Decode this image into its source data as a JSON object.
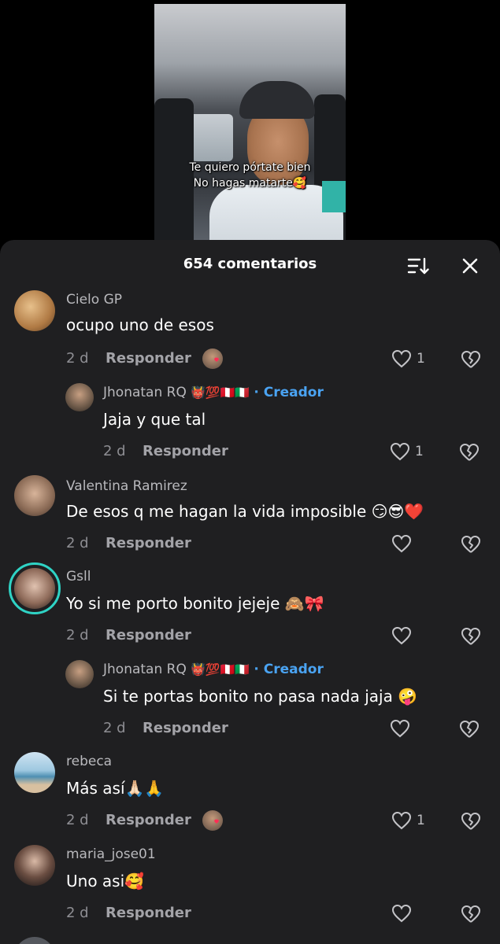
{
  "video": {
    "caption_line1": "Te quiero pórtate bien",
    "caption_line2": "No hagas matarte🥰"
  },
  "header": {
    "title": "654 comentarios",
    "sort_icon": "sort-icon",
    "close_icon": "close-icon"
  },
  "comments": [
    {
      "user": "Cielo GP",
      "text": "ocupo uno de esos",
      "time": "2 d",
      "reply_label": "Responder",
      "likes": "1",
      "creator_liked": true
    },
    {
      "user": "Jhonatan RQ",
      "badges": "👹💯🇵🇪🇮🇹",
      "creator_label": "· Creador",
      "text": "Jaja y que tal",
      "time": "2 d",
      "reply_label": "Responder",
      "likes": "1"
    },
    {
      "user": "Valentina Ramirez",
      "text": "De esos q me hagan la vida imposible 😏😎❤️",
      "time": "2 d",
      "reply_label": "Responder",
      "likes": ""
    },
    {
      "user": "Gsll",
      "text": "Yo si me porto bonito jejeje 🙈🎀",
      "time": "2 d",
      "reply_label": "Responder",
      "likes": ""
    },
    {
      "user": "Jhonatan RQ",
      "badges": "👹💯🇵🇪🇮🇹",
      "creator_label": "· Creador",
      "text": "Si te portas bonito no pasa nada jaja 🤪",
      "time": "2 d",
      "reply_label": "Responder",
      "likes": ""
    },
    {
      "user": "rebeca",
      "text": "Más así🙏🏻🙏",
      "time": "2 d",
      "reply_label": "Responder",
      "likes": "1",
      "creator_liked": true
    },
    {
      "user": "maria_jose01",
      "text": "Uno asi🥰",
      "time": "2 d",
      "reply_label": "Responder",
      "likes": ""
    }
  ],
  "colors": {
    "sheet_bg": "#1f1f21",
    "creator_blue": "#4aa3f2",
    "username_gray": "#b9b9bd",
    "meta_gray": "#8e8e93"
  }
}
